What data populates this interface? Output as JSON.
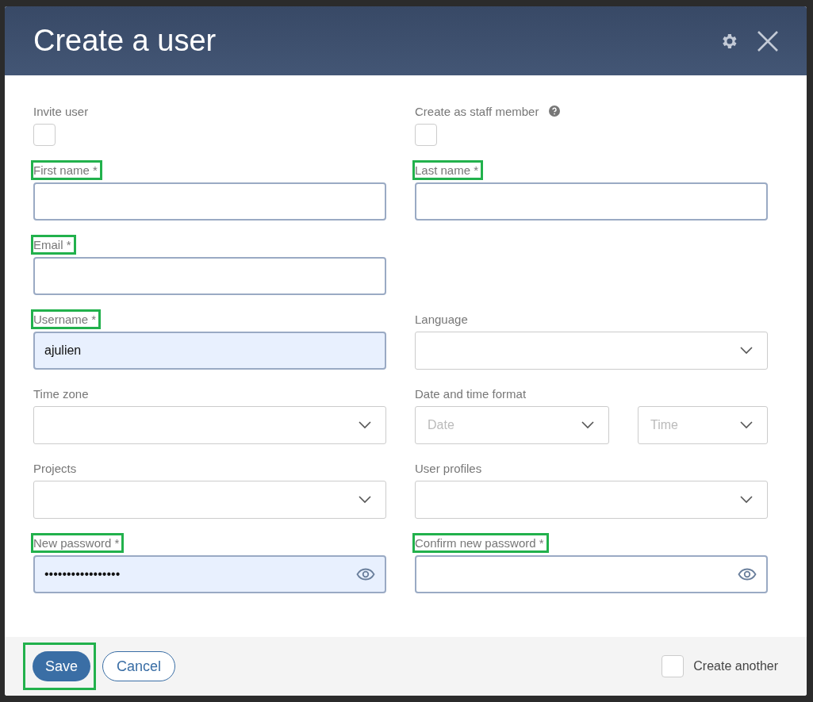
{
  "dialog": {
    "title": "Create a user"
  },
  "rows": [
    [
      {
        "kind": "checkbox",
        "label": "Invite user",
        "checked": false,
        "help": false,
        "highlighted": false
      },
      {
        "kind": "checkbox",
        "label": "Create as staff member",
        "checked": false,
        "help": true,
        "highlighted": false
      }
    ],
    [
      {
        "kind": "text",
        "label": "First name *",
        "autofilled": false,
        "highlighted": true
      },
      {
        "kind": "text",
        "label": "Last name *",
        "autofilled": false,
        "highlighted": true
      }
    ],
    [
      {
        "kind": "text",
        "label": "Email *",
        "autofilled": false,
        "highlighted": true
      }
    ],
    [
      {
        "kind": "text",
        "label": "Username *",
        "value": "ajulien",
        "autofilled": true,
        "highlighted": true
      },
      {
        "kind": "select",
        "label": "Language",
        "highlighted": false
      }
    ],
    [
      {
        "kind": "select",
        "label": "Time zone",
        "highlighted": false
      },
      {
        "kind": "dual-select",
        "label": "Date and time format",
        "placeholders": [
          "Date",
          "Time"
        ],
        "highlighted": false
      }
    ],
    [
      {
        "kind": "select",
        "label": "Projects",
        "highlighted": false
      },
      {
        "kind": "select",
        "label": "User profiles",
        "highlighted": false
      }
    ],
    [
      {
        "kind": "password",
        "label": "New password *",
        "value": "•••••••••••••••••",
        "autofilled": true,
        "highlighted": true
      },
      {
        "kind": "password",
        "label": "Confirm new password *",
        "autofilled": false,
        "highlighted": true
      }
    ]
  ],
  "footer": {
    "save": {
      "label": "Save",
      "highlighted": true
    },
    "cancel": {
      "label": "Cancel"
    },
    "create_another": {
      "label": "Create another",
      "checked": false
    }
  }
}
